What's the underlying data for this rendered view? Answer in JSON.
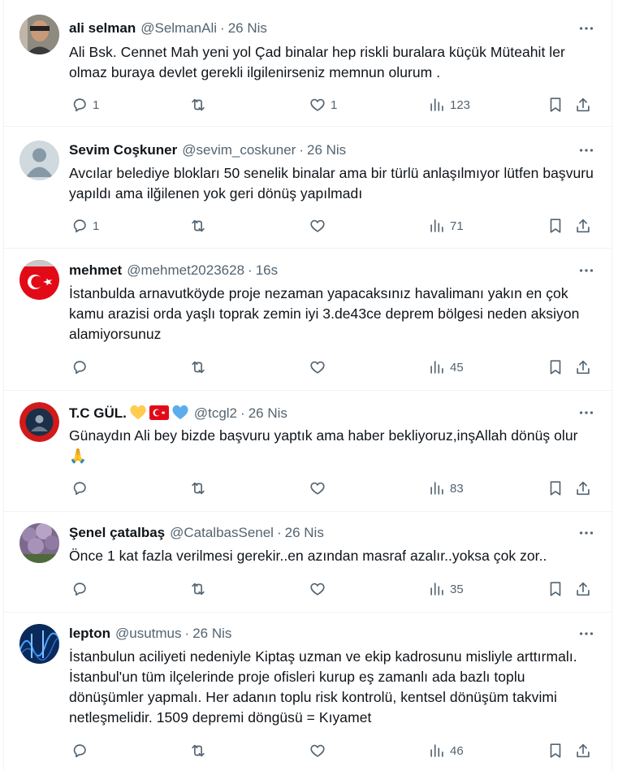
{
  "replies": [
    {
      "name": "ali selman",
      "handle": "@SelmanAli",
      "time": "26 Nis",
      "text": "Ali Bsk. Cennet Mah yeni yol Çad binalar hep riskli buralara küçük Müteahit ler olmaz buraya devlet gerekli ilgilenirseniz memnun olurum .",
      "reply_count": "1",
      "retweet_count": "",
      "like_count": "1",
      "view_count": "123"
    },
    {
      "name": "Sevim Coşkuner",
      "handle": "@sevim_coskuner",
      "time": "26 Nis",
      "text": "Avcılar belediye blokları 50 senelik binalar ama bir türlü anlaşılmıyor lütfen başvuru yapıldı ama ilğilenen yok geri dönüş yapılmadı",
      "reply_count": "1",
      "retweet_count": "",
      "like_count": "",
      "view_count": "71"
    },
    {
      "name": "mehmet",
      "handle": "@mehmet2023628",
      "time": "16s",
      "text": "İstanbulda arnavutköyde proje nezaman yapacaksınız havalimanı yakın en çok kamu arazisi orda yaşlı toprak zemin iyi 3.de43ce deprem bölgesi neden aksiyon alamiyorsunuz",
      "reply_count": "",
      "retweet_count": "",
      "like_count": "",
      "view_count": "45"
    },
    {
      "name": "T.C GÜL.",
      "handle": "@tcgl2",
      "time": "26 Nis",
      "text": "Günaydın Ali bey bizde başvuru yaptık ama haber bekliyoruz,inşAllah dönüş olur 🙏",
      "reply_count": "",
      "retweet_count": "",
      "like_count": "",
      "view_count": "83"
    },
    {
      "name": "Şenel çatalbaş",
      "handle": "@CatalbasSenel",
      "time": "26 Nis",
      "text": "Önce 1 kat fazla verilmesi gerekir..en azından masraf azalır..yoksa çok zor..",
      "reply_count": "",
      "retweet_count": "",
      "like_count": "",
      "view_count": "35"
    },
    {
      "name": "lepton",
      "handle": "@usutmus",
      "time": "26 Nis",
      "text": "İstanbulun aciliyeti nedeniyle Kiptaş uzman ve ekip kadrosunu misliyle arttırmalı. İstanbul'un tüm ilçelerinde proje ofisleri kurup eş zamanlı ada bazlı toplu dönüşümler yapmalı. Her adanın toplu risk kontrolü, kentsel dönüşüm takvimi netleşmelidir. 1509 depremi döngüsü = Kıyamet",
      "reply_count": "",
      "retweet_count": "",
      "like_count": "",
      "view_count": "46"
    }
  ],
  "colors": {
    "text_primary": "#0f1419",
    "text_secondary": "#536471",
    "border": "#eff3f4"
  },
  "icons": [
    "more-icon",
    "reply-icon",
    "retweet-icon",
    "like-icon",
    "views-icon",
    "bookmark-icon",
    "share-icon",
    "yellow-heart-icon",
    "turkey-flag-icon",
    "blue-heart-icon"
  ]
}
